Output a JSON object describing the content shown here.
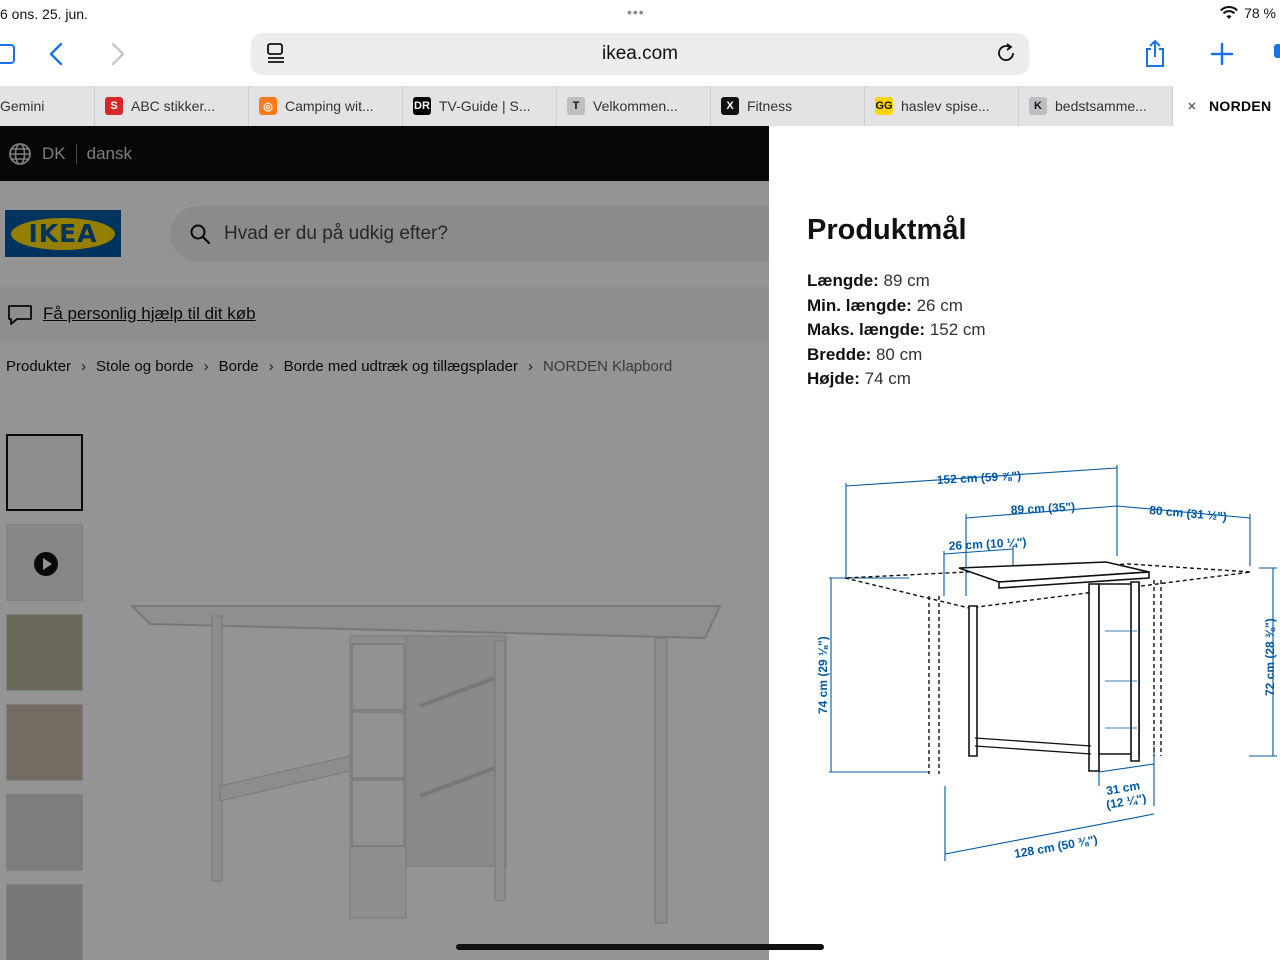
{
  "status_bar": {
    "time_date": "6  ons. 25. jun.",
    "battery": "78 %"
  },
  "browser": {
    "url": "ikea.com",
    "tabs": [
      {
        "label": "Gemini",
        "favicon": "gemini-icon",
        "fav_text": "",
        "fav_color": "#e3e3e6"
      },
      {
        "label": "ABC stikker...",
        "favicon": "s-logo-icon",
        "fav_text": "S",
        "fav_color": "#d62828"
      },
      {
        "label": "Camping wit...",
        "favicon": "camping-icon",
        "fav_text": "◎",
        "fav_color": "#ff7a1a"
      },
      {
        "label": "TV-Guide | S...",
        "favicon": "dr-logo-icon",
        "fav_text": "DR",
        "fav_color": "#000000"
      },
      {
        "label": "Velkommen...",
        "favicon": "t-letter-icon",
        "fav_text": "T",
        "fav_color": "#bdbdc2"
      },
      {
        "label": "Fitness",
        "favicon": "x-logo-icon",
        "fav_text": "X",
        "fav_color": "#111111"
      },
      {
        "label": "haslev spise...",
        "favicon": "gg-logo-icon",
        "fav_text": "GG",
        "fav_color": "#ffd400"
      },
      {
        "label": "bedstsamme...",
        "favicon": "k-letter-icon",
        "fav_text": "K",
        "fav_color": "#bdbdc2"
      },
      {
        "label": "NORDEN",
        "favicon": "close-tab-icon",
        "fav_text": "✕",
        "fav_color": "#ffffff"
      }
    ]
  },
  "ikea": {
    "country": "DK",
    "language": "dansk",
    "logo_text": "IKEA",
    "search_placeholder": "Hvad er du på udkig efter?",
    "help_link": "Få personlig hjælp til dit køb",
    "breadcrumb": [
      "Produkter",
      "Stole og borde",
      "Borde",
      "Borde med udtræk og tillægsplader",
      "NORDEN Klapbord"
    ]
  },
  "panel": {
    "title": "Produktmål",
    "dimensions": [
      {
        "label": "Længde:",
        "value": "89 cm"
      },
      {
        "label": "Min. længde:",
        "value": "26 cm"
      },
      {
        "label": "Maks. længde:",
        "value": "152 cm"
      },
      {
        "label": "Bredde:",
        "value": "80 cm"
      },
      {
        "label": "Højde:",
        "value": "74 cm"
      }
    ],
    "diagram_labels": {
      "max_length": "152 cm (59 ⅞\")",
      "length": "89 cm (35\")",
      "width": "80 cm (31 ½\")",
      "min_length": "26 cm (10 ¼\")",
      "height": "74 cm (29 ⅛\")",
      "inner_height": "72 cm (28 ⅜\")",
      "leg_depth_1": "31 cm",
      "leg_depth_2": "(12 ¼\")",
      "base": "128 cm (50 ⅜\")"
    },
    "accent_color": "#0058a3"
  }
}
